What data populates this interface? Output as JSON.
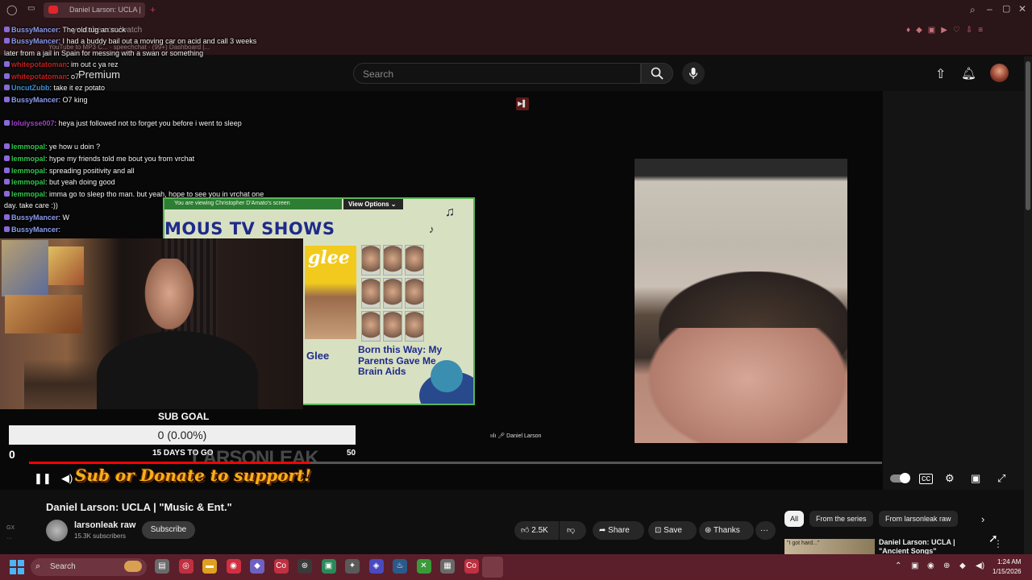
{
  "browser": {
    "tab_title": "Daniel Larson: UCLA |",
    "url": "youtube.com/watch",
    "bookmarks": "YouTube to MP3 C...   ·   speechchat   ·   (99+) Dashboard |...",
    "new_tab": "+",
    "icons": [
      "opera-logo-icon",
      "sidebar-icon",
      "search-icon",
      "minimize-icon",
      "maximize-icon",
      "close-icon"
    ]
  },
  "youtube": {
    "premium_label": "Premium",
    "search_placeholder": "Search",
    "icons": [
      "search-icon",
      "mic-icon",
      "upload-icon",
      "bell-icon",
      "avatar"
    ]
  },
  "chat": [
    {
      "user": "BussyMancer",
      "cls": "u-bussy",
      "msg": "The old tug an suck"
    },
    {
      "user": "BussyMancer",
      "cls": "u-bussy",
      "msg": "I had a buddy bail out a moving car on acid and call 3 weeks"
    },
    {
      "user": "",
      "cls": "",
      "msg": "later from a jail in Spain for messing with a swan or something"
    },
    {
      "user": "whitepotatoman",
      "cls": "u-white",
      "msg": "im out c ya rez"
    },
    {
      "user": "whitepotatoman",
      "cls": "u-white",
      "msg": "o7"
    },
    {
      "user": "UncutZubb",
      "cls": "u-uncut",
      "msg": "take it ez potato"
    },
    {
      "user": "BussyMancer",
      "cls": "u-bussy",
      "msg": "O7 king"
    },
    {
      "user": "loluiysse007",
      "cls": "u-lolu",
      "msg": "heya just followed not to forget you before i went to sleep"
    },
    {
      "user": "lemmopal",
      "cls": "u-lemm",
      "msg": "ye how u doin ?"
    },
    {
      "user": "lemmopal",
      "cls": "u-lemm",
      "msg": "hype my friends told me bout you from vrchat"
    },
    {
      "user": "lemmopal",
      "cls": "u-lemm",
      "msg": "spreading positivity and all"
    },
    {
      "user": "lemmopal",
      "cls": "u-lemm",
      "msg": "but yeah doing good"
    },
    {
      "user": "lemmopal",
      "cls": "u-lemm",
      "msg": "imma go to sleep tho man. but yeah, hope to see you in vrchat one"
    },
    {
      "user": "",
      "cls": "",
      "msg": "day. take care :))"
    },
    {
      "user": "BussyMancer",
      "cls": "u-bussy",
      "msg": "W"
    },
    {
      "user": "BussyMancer",
      "cls": "u-bussy",
      "msg": ""
    }
  ],
  "screen_share": {
    "viewing_label": "You are viewing  Christopher D'Amato's screen",
    "view_options": "View Options",
    "headline": "MOUS TV SHOWS",
    "glee_logo": "glee",
    "glee_caption": "Glee",
    "born_caption": "Born this Way: My Parents Gave Me Brain Aids",
    "cam_label": "Daniel Larson"
  },
  "sub_goal": {
    "label": "SUB GOAL",
    "bar_text": "0 (0.00%)",
    "start": "0",
    "days": "15 DAYS TO GO",
    "end": "50",
    "progress_fraction": 0
  },
  "overlay": {
    "watermark": "LARSONLEAK",
    "donate_banner": "Sub or Donate to support!"
  },
  "player": {
    "played_fraction": 0.33,
    "controls": [
      "pause-icon",
      "volume-icon",
      "autoplay-toggle",
      "cc-icon",
      "settings-icon",
      "miniplayer-icon",
      "fullscreen-icon"
    ]
  },
  "video": {
    "title": "Daniel Larson: UCLA | \"Music & Ent.\"",
    "channel": "larsonleak raw",
    "subscribers": "15.3K subscribers",
    "subscribe": "Subscribe",
    "likes": "2.5K",
    "share": "Share",
    "save": "Save",
    "thanks": "Thanks",
    "more": "···"
  },
  "sidebar": {
    "chips": [
      "All",
      "From the series",
      "From larsonleak raw"
    ],
    "rec_thumb_text": "\"I got hard...\"",
    "rec_title": "Daniel Larson: UCLA | \"Ancient Songs\""
  },
  "left_rail": "GX",
  "taskbar": {
    "search": "Search",
    "time": "1:24 AM",
    "date": "1/15/2026"
  }
}
